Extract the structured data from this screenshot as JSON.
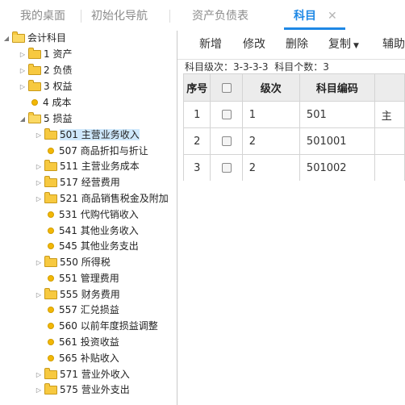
{
  "tabs": [
    {
      "label": "我的桌面"
    },
    {
      "label": "初始化导航"
    },
    {
      "label": "资产负债表"
    },
    {
      "label": "科目",
      "close": "✕"
    }
  ],
  "tree": {
    "root": "会计科目",
    "items": [
      {
        "label": "1 资产"
      },
      {
        "label": "2 负债"
      },
      {
        "label": "3 权益"
      },
      {
        "label": "4 成本"
      },
      {
        "label": "5 损益"
      },
      {
        "label": "501 主营业务收入"
      },
      {
        "label": "507 商品折扣与折让"
      },
      {
        "label": "511 主营业务成本"
      },
      {
        "label": "517 经营费用"
      },
      {
        "label": "521 商品销售税金及附加"
      },
      {
        "label": "531 代购代销收入"
      },
      {
        "label": "541 其他业务收入"
      },
      {
        "label": "545 其他业务支出"
      },
      {
        "label": "550 所得税"
      },
      {
        "label": "551 管理费用"
      },
      {
        "label": "555 财务费用"
      },
      {
        "label": "557 汇兑损益"
      },
      {
        "label": "560 以前年度损益调整"
      },
      {
        "label": "561 投资收益"
      },
      {
        "label": "565 补贴收入"
      },
      {
        "label": "571 营业外收入"
      },
      {
        "label": "575 营业外支出"
      }
    ]
  },
  "toolbar": {
    "add": "新增",
    "edit": "修改",
    "delete": "删除",
    "copy": "复制",
    "aux": "辅助"
  },
  "info": {
    "level_label": "科目级次：",
    "level_value": "3-3-3-3",
    "count_label": "科目个数：",
    "count_value": "3"
  },
  "grid": {
    "headers": [
      "序号",
      "",
      "级次",
      "科目编码",
      ""
    ],
    "rows": [
      {
        "no": "1",
        "level": "1",
        "code": "501",
        "name": "主"
      },
      {
        "no": "2",
        "level": "2",
        "code": "501001",
        "name": ""
      },
      {
        "no": "3",
        "level": "2",
        "code": "501002",
        "name": ""
      }
    ]
  },
  "colors": {
    "accent": "#1e88e5",
    "folder": "#f7c940",
    "dot": "#f2b705",
    "selection": "#cfe8fc"
  }
}
